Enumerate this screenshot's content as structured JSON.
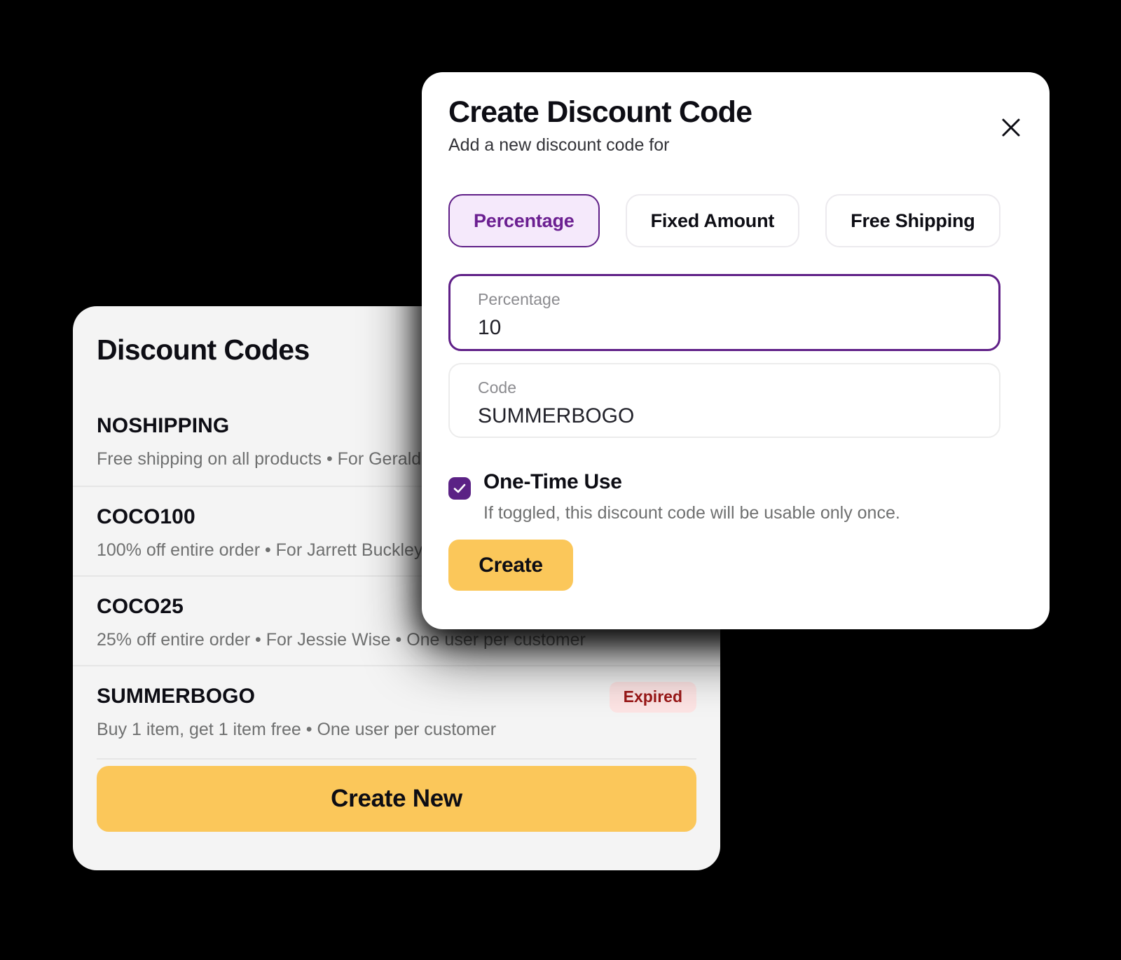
{
  "list_card": {
    "title": "Discount Codes",
    "codes": [
      {
        "code": "NOSHIPPING",
        "description": "Free shipping on all products • For Gerald",
        "status": ""
      },
      {
        "code": "COCO100",
        "description": "100% off entire order • For Jarrett Buckley",
        "status": ""
      },
      {
        "code": "COCO25",
        "description": "25% off entire order • For Jessie Wise • One user per customer",
        "status": ""
      },
      {
        "code": "SUMMERBOGO",
        "description": "Buy 1 item, get 1 item free • One user per customer",
        "status": "Expired"
      }
    ],
    "create_new_label": "Create New"
  },
  "modal": {
    "title": "Create Discount Code",
    "subtitle": "Add a new discount code for",
    "close_icon": "close-icon",
    "type_options": [
      {
        "label": "Percentage",
        "selected": true
      },
      {
        "label": "Fixed Amount",
        "selected": false
      },
      {
        "label": "Free Shipping",
        "selected": false
      }
    ],
    "fields": {
      "percentage": {
        "label": "Percentage",
        "value": "10",
        "focused": true
      },
      "code": {
        "label": "Code",
        "value": "SUMMERBOGO",
        "focused": false
      }
    },
    "one_time_use": {
      "checked": true,
      "title": "One-Time Use",
      "description": "If toggled, this discount code will be usable only once.",
      "check_icon": "check-icon"
    },
    "submit_label": "Create"
  },
  "colors": {
    "page_background": "#000000",
    "card_background": "#f4f4f4",
    "modal_background": "#ffffff",
    "accent_purple": "#5f1f87",
    "accent_purple_soft": "#f5e9fb",
    "accent_yellow": "#fbc75a",
    "badge_expired_bg": "#fde4e4",
    "badge_expired_text": "#9b1717",
    "muted_text": "#6f7070",
    "divider": "#e6e6e6"
  }
}
